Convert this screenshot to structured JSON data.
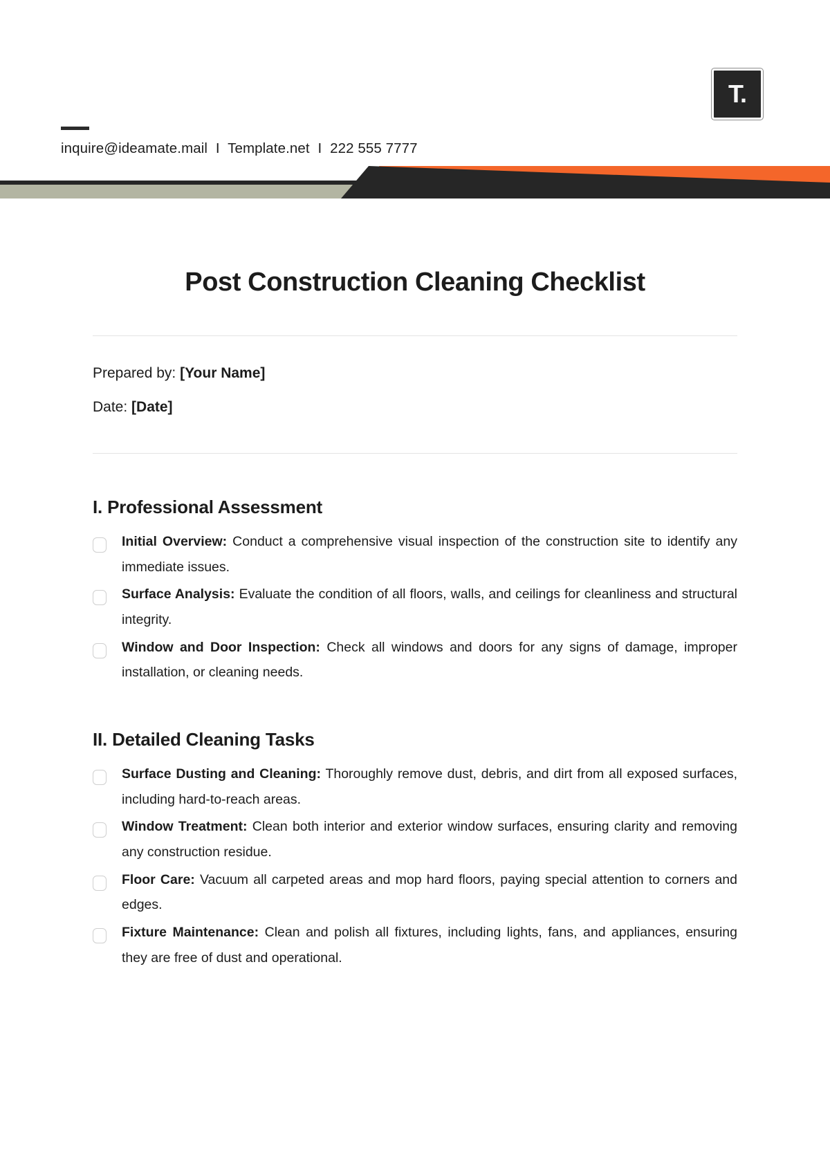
{
  "brand": {
    "logo_text": "T.",
    "accent_orange": "#f4662a",
    "accent_sage": "#b3b5a2",
    "accent_dark": "#262626"
  },
  "header": {
    "email": "inquire@ideamate.mail",
    "separator": "I",
    "website": "Template.net",
    "phone": "222 555 7777"
  },
  "document": {
    "title": "Post Construction Cleaning Checklist",
    "prepared_by_label": "Prepared by:",
    "prepared_by_value": "[Your Name]",
    "date_label": "Date:",
    "date_value": "[Date]"
  },
  "sections": [
    {
      "heading": "I. Professional Assessment",
      "items": [
        {
          "label": "Initial Overview:",
          "text": " Conduct a comprehensive visual inspection of the construction site to identify any immediate issues."
        },
        {
          "label": "Surface Analysis:",
          "text": " Evaluate the condition of all floors, walls, and ceilings for cleanliness and structural integrity."
        },
        {
          "label": "Window and Door Inspection:",
          "text": " Check all windows and doors for any signs of damage, improper installation, or cleaning needs."
        }
      ]
    },
    {
      "heading": "II. Detailed Cleaning Tasks",
      "items": [
        {
          "label": "Surface Dusting and Cleaning:",
          "text": " Thoroughly remove dust, debris, and dirt from all exposed surfaces, including hard-to-reach areas."
        },
        {
          "label": "Window Treatment:",
          "text": " Clean both interior and exterior window surfaces, ensuring clarity and removing any construction residue."
        },
        {
          "label": "Floor Care:",
          "text": " Vacuum all carpeted areas and mop hard floors, paying special attention to corners and edges."
        },
        {
          "label": "Fixture Maintenance:",
          "text": " Clean and polish all fixtures, including lights, fans, and appliances, ensuring they are free of dust and operational."
        }
      ]
    }
  ]
}
